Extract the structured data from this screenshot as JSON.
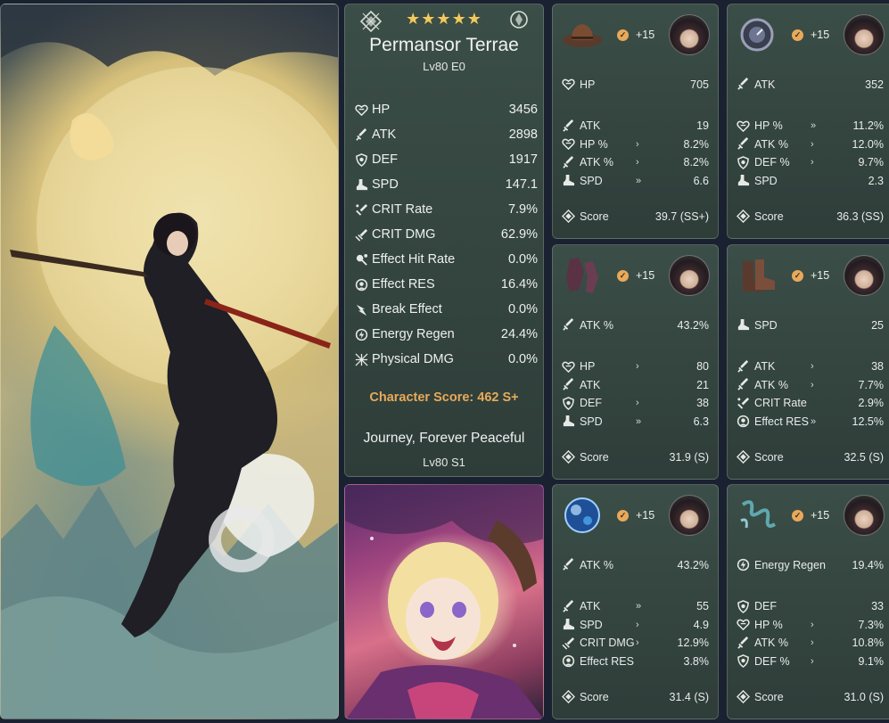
{
  "character": {
    "rarity_stars": "★★★★★",
    "name": "Permansor Terrae",
    "level": "Lv80 E0",
    "stats": [
      {
        "icon": "heart-icon",
        "label": "HP",
        "value": "3456"
      },
      {
        "icon": "sword-icon",
        "label": "ATK",
        "value": "2898"
      },
      {
        "icon": "shield-icon",
        "label": "DEF",
        "value": "1917"
      },
      {
        "icon": "boot-icon",
        "label": "SPD",
        "value": "147.1"
      },
      {
        "icon": "crit-rate-icon",
        "label": "CRIT Rate",
        "value": "7.9%"
      },
      {
        "icon": "crit-dmg-icon",
        "label": "CRIT DMG",
        "value": "62.9%"
      },
      {
        "icon": "effect-hit-icon",
        "label": "Effect Hit Rate",
        "value": "0.0%"
      },
      {
        "icon": "effect-res-icon",
        "label": "Effect RES",
        "value": "16.4%"
      },
      {
        "icon": "break-icon",
        "label": "Break Effect",
        "value": "0.0%"
      },
      {
        "icon": "energy-icon",
        "label": "Energy Regen",
        "value": "24.4%"
      },
      {
        "icon": "physical-icon",
        "label": "Physical DMG",
        "value": "0.0%"
      }
    ],
    "score": "Character Score: 462 S+"
  },
  "light_cone": {
    "name": "Journey, Forever Peaceful",
    "level": "Lv80 S1"
  },
  "relics": [
    {
      "id": "head",
      "level": "+15",
      "main": {
        "label": "HP",
        "value": "705",
        "icon": "heart-icon"
      },
      "subs": [
        {
          "label": "ATK",
          "arrow": "",
          "value": "19",
          "icon": "sword-icon"
        },
        {
          "label": "HP %",
          "arrow": "›",
          "value": "8.2%",
          "icon": "heart-icon"
        },
        {
          "label": "ATK %",
          "arrow": "›",
          "value": "8.2%",
          "icon": "sword-icon"
        },
        {
          "label": "SPD",
          "arrow": "»",
          "value": "6.6",
          "icon": "boot-icon"
        }
      ],
      "score_label": "Score",
      "score": "39.7 (SS+)"
    },
    {
      "id": "hands",
      "level": "+15",
      "main": {
        "label": "ATK",
        "value": "352",
        "icon": "sword-icon"
      },
      "subs": [
        {
          "label": "HP %",
          "arrow": "»",
          "value": "11.2%",
          "icon": "heart-icon"
        },
        {
          "label": "ATK %",
          "arrow": "›",
          "value": "12.0%",
          "icon": "sword-icon"
        },
        {
          "label": "DEF %",
          "arrow": "›",
          "value": "9.7%",
          "icon": "shield-icon"
        },
        {
          "label": "SPD",
          "arrow": "",
          "value": "2.3",
          "icon": "boot-icon"
        }
      ],
      "score_label": "Score",
      "score": "36.3 (SS)"
    },
    {
      "id": "body",
      "level": "+15",
      "main": {
        "label": "ATK %",
        "value": "43.2%",
        "icon": "sword-icon"
      },
      "subs": [
        {
          "label": "HP",
          "arrow": "›",
          "value": "80",
          "icon": "heart-icon"
        },
        {
          "label": "ATK",
          "arrow": "",
          "value": "21",
          "icon": "sword-icon"
        },
        {
          "label": "DEF",
          "arrow": "›",
          "value": "38",
          "icon": "shield-icon"
        },
        {
          "label": "SPD",
          "arrow": "»",
          "value": "6.3",
          "icon": "boot-icon"
        }
      ],
      "score_label": "Score",
      "score": "31.9 (S)"
    },
    {
      "id": "feet",
      "level": "+15",
      "main": {
        "label": "SPD",
        "value": "25",
        "icon": "boot-icon"
      },
      "subs": [
        {
          "label": "ATK",
          "arrow": "›",
          "value": "38",
          "icon": "sword-icon"
        },
        {
          "label": "ATK %",
          "arrow": "›",
          "value": "7.7%",
          "icon": "sword-icon"
        },
        {
          "label": "CRIT Rate",
          "arrow": "",
          "value": "2.9%",
          "icon": "crit-rate-icon"
        },
        {
          "label": "Effect RES",
          "arrow": "»",
          "value": "12.5%",
          "icon": "effect-res-icon"
        }
      ],
      "score_label": "Score",
      "score": "32.5 (S)"
    },
    {
      "id": "sphere",
      "level": "+15",
      "main": {
        "label": "ATK %",
        "value": "43.2%",
        "icon": "sword-icon"
      },
      "subs": [
        {
          "label": "ATK",
          "arrow": "»",
          "value": "55",
          "icon": "sword-icon"
        },
        {
          "label": "SPD",
          "arrow": "›",
          "value": "4.9",
          "icon": "boot-icon"
        },
        {
          "label": "CRIT DMG",
          "arrow": "›",
          "value": "12.9%",
          "icon": "crit-dmg-icon"
        },
        {
          "label": "Effect RES",
          "arrow": "",
          "value": "3.8%",
          "icon": "effect-res-icon"
        }
      ],
      "score_label": "Score",
      "score": "31.4 (S)"
    },
    {
      "id": "rope",
      "level": "+15",
      "main": {
        "label": "Energy Regen",
        "value": "19.4%",
        "icon": "energy-icon"
      },
      "subs": [
        {
          "label": "DEF",
          "arrow": "",
          "value": "33",
          "icon": "shield-icon"
        },
        {
          "label": "HP %",
          "arrow": "›",
          "value": "7.3%",
          "icon": "heart-icon"
        },
        {
          "label": "ATK %",
          "arrow": "›",
          "value": "10.8%",
          "icon": "sword-icon"
        },
        {
          "label": "DEF %",
          "arrow": "›",
          "value": "9.1%",
          "icon": "shield-icon"
        }
      ],
      "score_label": "Score",
      "score": "31.0 (S)"
    }
  ],
  "colors": {
    "accent_score": "#e9a95a",
    "star": "#f3c95c",
    "card_bg": "#3e524a"
  }
}
